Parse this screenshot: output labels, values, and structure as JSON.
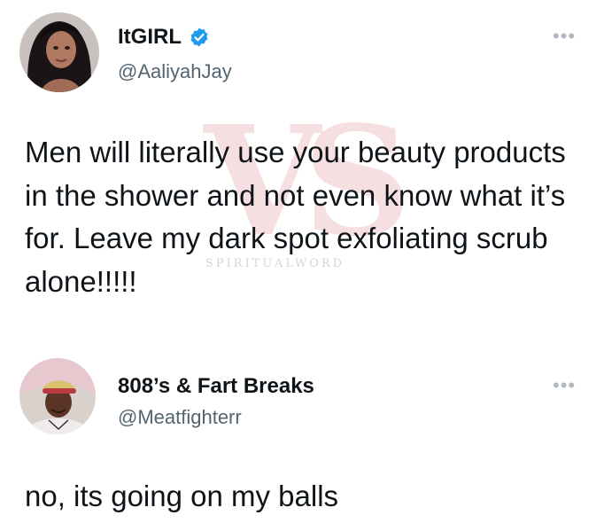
{
  "tweets": [
    {
      "display_name": "ItGIRL",
      "handle": "@AaliyahJay",
      "verified": true,
      "more_glyph": "•••",
      "text": "Men will literally use your beauty products in the shower and not even know what it’s for. Leave my dark spot exfoliating scrub alone!!!!!"
    },
    {
      "display_name": "808’s & Fart Breaks",
      "handle": "@Meatfighterr",
      "verified": false,
      "more_glyph": "•••",
      "text": "no, its going on my balls"
    }
  ],
  "watermark": {
    "logo_letters": "VS",
    "text": "SPIRITUALWORD"
  },
  "colors": {
    "text": "#0f1419",
    "secondary_text": "#536471",
    "verified_badge": "#1d9bf0"
  }
}
